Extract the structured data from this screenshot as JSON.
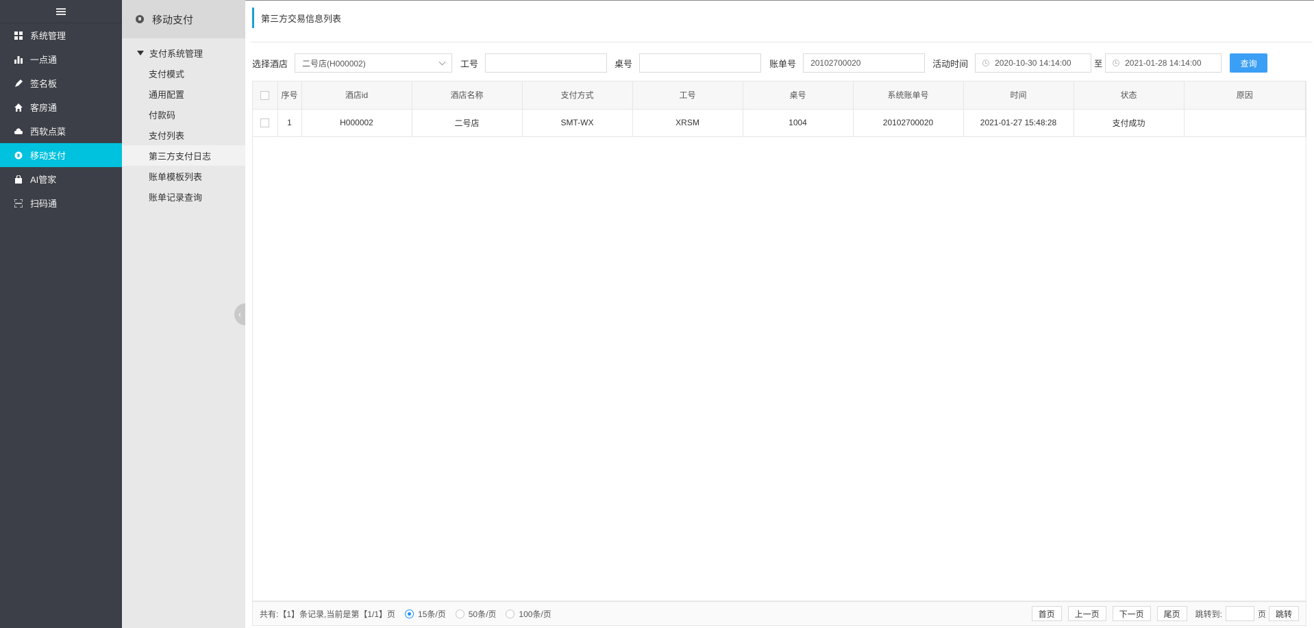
{
  "nav": {
    "items": [
      {
        "label": "系统管理",
        "icon": "grid-icon"
      },
      {
        "label": "一点通",
        "icon": "bar-chart-icon"
      },
      {
        "label": "签名板",
        "icon": "pen-icon"
      },
      {
        "label": "客房通",
        "icon": "home-icon"
      },
      {
        "label": "西软点菜",
        "icon": "cloud-icon"
      },
      {
        "label": "移动支付",
        "icon": "wallet-icon",
        "active": true
      },
      {
        "label": "AI管家",
        "icon": "bag-icon"
      },
      {
        "label": "扫码通",
        "icon": "scan-icon"
      }
    ]
  },
  "subnav": {
    "title": "移动支付",
    "group": "支付系统管理",
    "items": [
      "支付模式",
      "通用配置",
      "付款码",
      "支付列表",
      "第三方支付日志",
      "账单模板列表",
      "账单记录查询"
    ]
  },
  "main": {
    "title": "第三方交易信息列表",
    "filters": {
      "hotel_label": "选择酒店",
      "hotel_value": "二号店(H000002)",
      "staff_label": "工号",
      "staff_value": "",
      "table_label": "桌号",
      "table_value": "",
      "bill_label": "账单号",
      "bill_value": "20102700020",
      "time_label": "活动时间",
      "time_start": "2020-10-30 14:14:00",
      "time_sep": "至",
      "time_end": "2021-01-28 14:14:00",
      "query_label": "查询"
    },
    "table": {
      "headers": [
        "序号",
        "酒店id",
        "酒店名称",
        "支付方式",
        "工号",
        "桌号",
        "系统账单号",
        "时间",
        "状态",
        "原因"
      ],
      "rows": [
        [
          "1",
          "H000002",
          "二号店",
          "SMT-WX",
          "XRSM",
          "1004",
          "20102700020",
          "2021-01-27 15:48:28",
          "支付成功",
          ""
        ]
      ]
    },
    "pager": {
      "summary": "共有:【1】条记录,当前是第【1/1】页",
      "size_15": "15条/页",
      "size_50": "50条/页",
      "size_100": "100条/页",
      "first": "首页",
      "prev": "上一页",
      "next": "下一页",
      "last": "尾页",
      "jump_label": "跳转到:",
      "page_unit": "页",
      "jump_btn": "跳转"
    }
  },
  "colors": {
    "active_nav": "#00c1de",
    "query_button": "#3a9ff5",
    "title_accent": "#1aa0d8"
  }
}
